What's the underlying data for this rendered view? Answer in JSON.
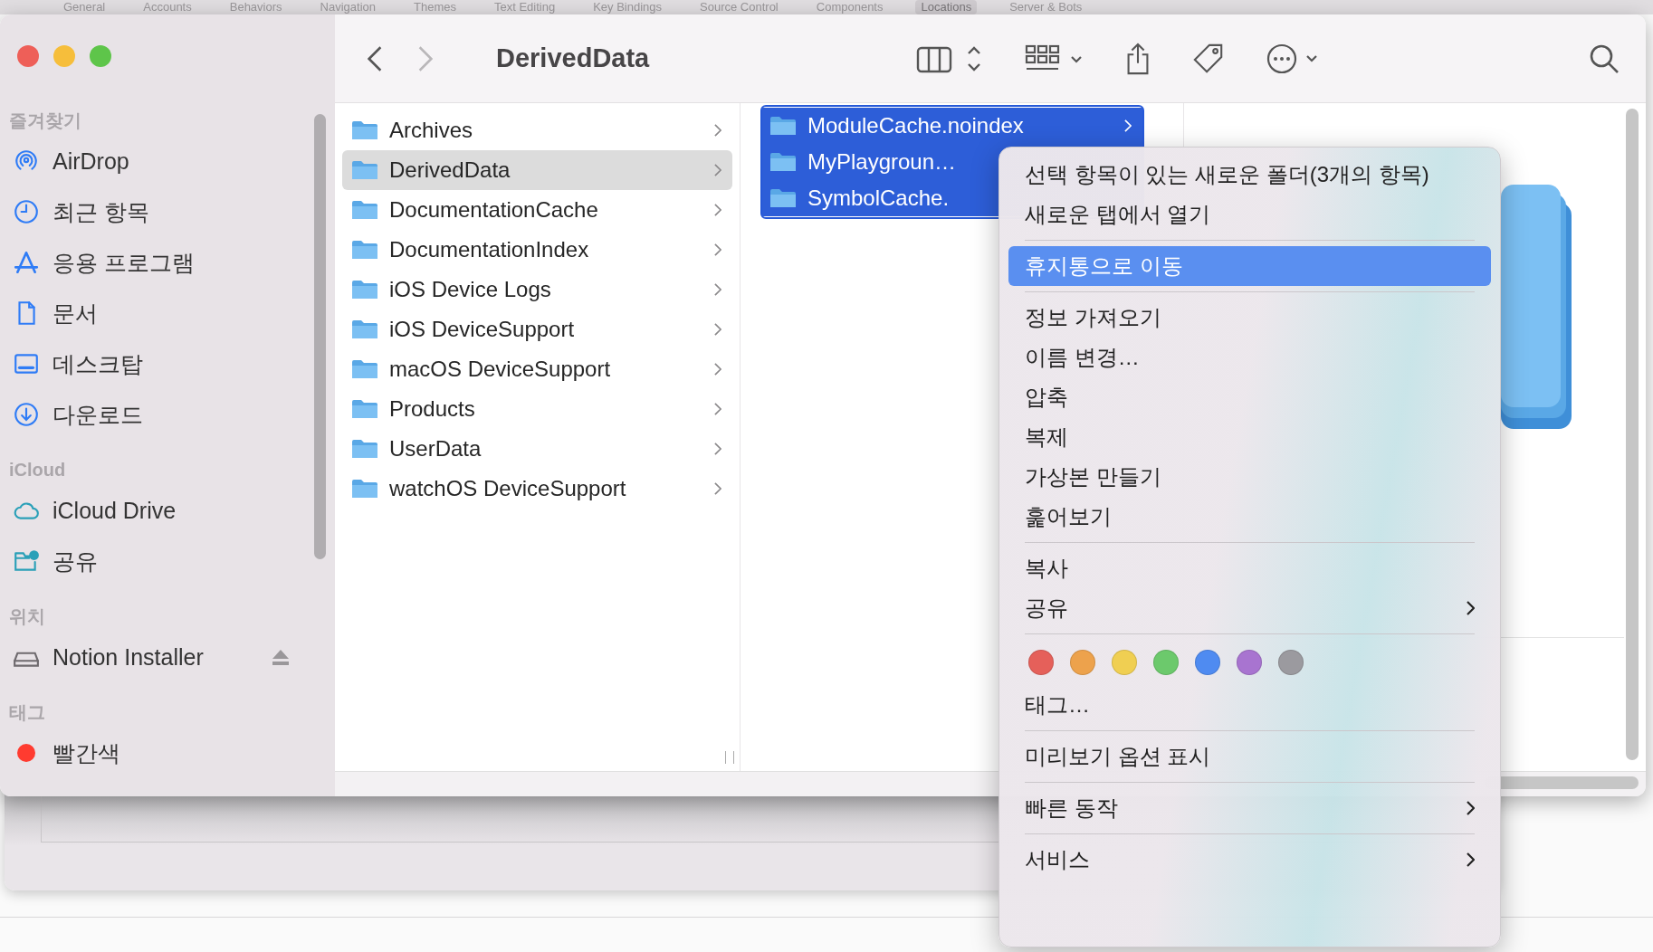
{
  "background_window": {
    "tabs": [
      {
        "label": "General",
        "selected": false
      },
      {
        "label": "Accounts",
        "selected": false
      },
      {
        "label": "Behaviors",
        "selected": false
      },
      {
        "label": "Navigation",
        "selected": false
      },
      {
        "label": "Themes",
        "selected": false
      },
      {
        "label": "Text Editing",
        "selected": false
      },
      {
        "label": "Key Bindings",
        "selected": false
      },
      {
        "label": "Source Control",
        "selected": false
      },
      {
        "label": "Components",
        "selected": false
      },
      {
        "label": "Locations",
        "selected": true
      },
      {
        "label": "Server & Bots",
        "selected": false
      }
    ]
  },
  "toolbar": {
    "title": "DerivedData",
    "back": {
      "disabled": false
    },
    "forward": {
      "disabled": true
    }
  },
  "sidebar": {
    "sections": [
      {
        "header": "즐겨찾기",
        "items": [
          {
            "label": "AirDrop",
            "kind": "airdrop"
          },
          {
            "label": "최근 항목",
            "kind": "recents"
          },
          {
            "label": "응용 프로그램",
            "kind": "applications"
          },
          {
            "label": "문서",
            "kind": "documents"
          },
          {
            "label": "데스크탑",
            "kind": "desktop"
          },
          {
            "label": "다운로드",
            "kind": "downloads"
          }
        ]
      },
      {
        "header": "iCloud",
        "items": [
          {
            "label": "iCloud Drive",
            "kind": "cloud"
          },
          {
            "label": "공유",
            "kind": "shared"
          }
        ]
      },
      {
        "header": "위치",
        "items": [
          {
            "label": "Notion Installer",
            "kind": "volume"
          }
        ]
      },
      {
        "header": "태그",
        "items": [
          {
            "label": "빨간색",
            "kind": "tag",
            "color": "#ff3b30"
          }
        ]
      }
    ]
  },
  "columns": [
    {
      "focused": false,
      "items": [
        {
          "name": "Archives",
          "selected": false,
          "has_children": true
        },
        {
          "name": "DerivedData",
          "selected": true,
          "has_children": true
        },
        {
          "name": "DocumentationCache",
          "selected": false,
          "has_children": true
        },
        {
          "name": "DocumentationIndex",
          "selected": false,
          "has_children": true
        },
        {
          "name": "iOS Device Logs",
          "selected": false,
          "has_children": true
        },
        {
          "name": "iOS DeviceSupport",
          "selected": false,
          "has_children": true
        },
        {
          "name": "macOS DeviceSupport",
          "selected": false,
          "has_children": true
        },
        {
          "name": "Products",
          "selected": false,
          "has_children": true
        },
        {
          "name": "UserData",
          "selected": false,
          "has_children": true
        },
        {
          "name": "watchOS DeviceSupport",
          "selected": false,
          "has_children": true
        }
      ]
    },
    {
      "focused": true,
      "items": [
        {
          "name": "ModuleCache.noindex",
          "selected": true,
          "has_children": true
        },
        {
          "name": "MyPlaygroun…",
          "selected": true,
          "has_children": false
        },
        {
          "name": "SymbolCache.",
          "selected": true,
          "has_children": false
        }
      ]
    }
  ],
  "context_menu": {
    "sections": [
      {
        "items": [
          {
            "kind": "command",
            "label": "선택 항목이 있는 새로운 폴더(3개의 항목)",
            "selected": false,
            "submenu": false
          },
          {
            "kind": "command",
            "label": "새로운 탭에서 열기",
            "selected": false,
            "submenu": false
          }
        ]
      },
      {
        "items": [
          {
            "kind": "command",
            "label": "휴지통으로 이동",
            "selected": true,
            "submenu": false
          }
        ]
      },
      {
        "items": [
          {
            "kind": "command",
            "label": "정보 가져오기",
            "selected": false,
            "submenu": false
          },
          {
            "kind": "command",
            "label": "이름 변경…",
            "selected": false,
            "submenu": false
          },
          {
            "kind": "command",
            "label": "압축",
            "selected": false,
            "submenu": false
          },
          {
            "kind": "command",
            "label": "복제",
            "selected": false,
            "submenu": false
          },
          {
            "kind": "command",
            "label": "가상본 만들기",
            "selected": false,
            "submenu": false
          },
          {
            "kind": "command",
            "label": "훑어보기",
            "selected": false,
            "submenu": false
          }
        ]
      },
      {
        "items": [
          {
            "kind": "command",
            "label": "복사",
            "selected": false,
            "submenu": false
          },
          {
            "kind": "command",
            "label": "공유",
            "selected": false,
            "submenu": true
          }
        ]
      },
      {
        "items": [
          {
            "kind": "tags",
            "colors": [
              {
                "color": "#e5605a"
              },
              {
                "color": "#eda24c"
              },
              {
                "color": "#f0cf52"
              },
              {
                "color": "#6cc96c"
              },
              {
                "color": "#4f8bf1"
              },
              {
                "color": "#a874d0"
              },
              {
                "color": "#9b9a9f"
              }
            ]
          },
          {
            "kind": "command",
            "label": "태그…",
            "selected": false,
            "submenu": false
          }
        ]
      },
      {
        "items": [
          {
            "kind": "command",
            "label": "미리보기 옵션 표시",
            "selected": false,
            "submenu": false
          }
        ]
      },
      {
        "items": [
          {
            "kind": "command",
            "label": "빠른 동작",
            "selected": false,
            "submenu": true
          }
        ]
      },
      {
        "items": [
          {
            "kind": "command",
            "label": "서비스",
            "selected": false,
            "submenu": true
          }
        ]
      }
    ]
  }
}
